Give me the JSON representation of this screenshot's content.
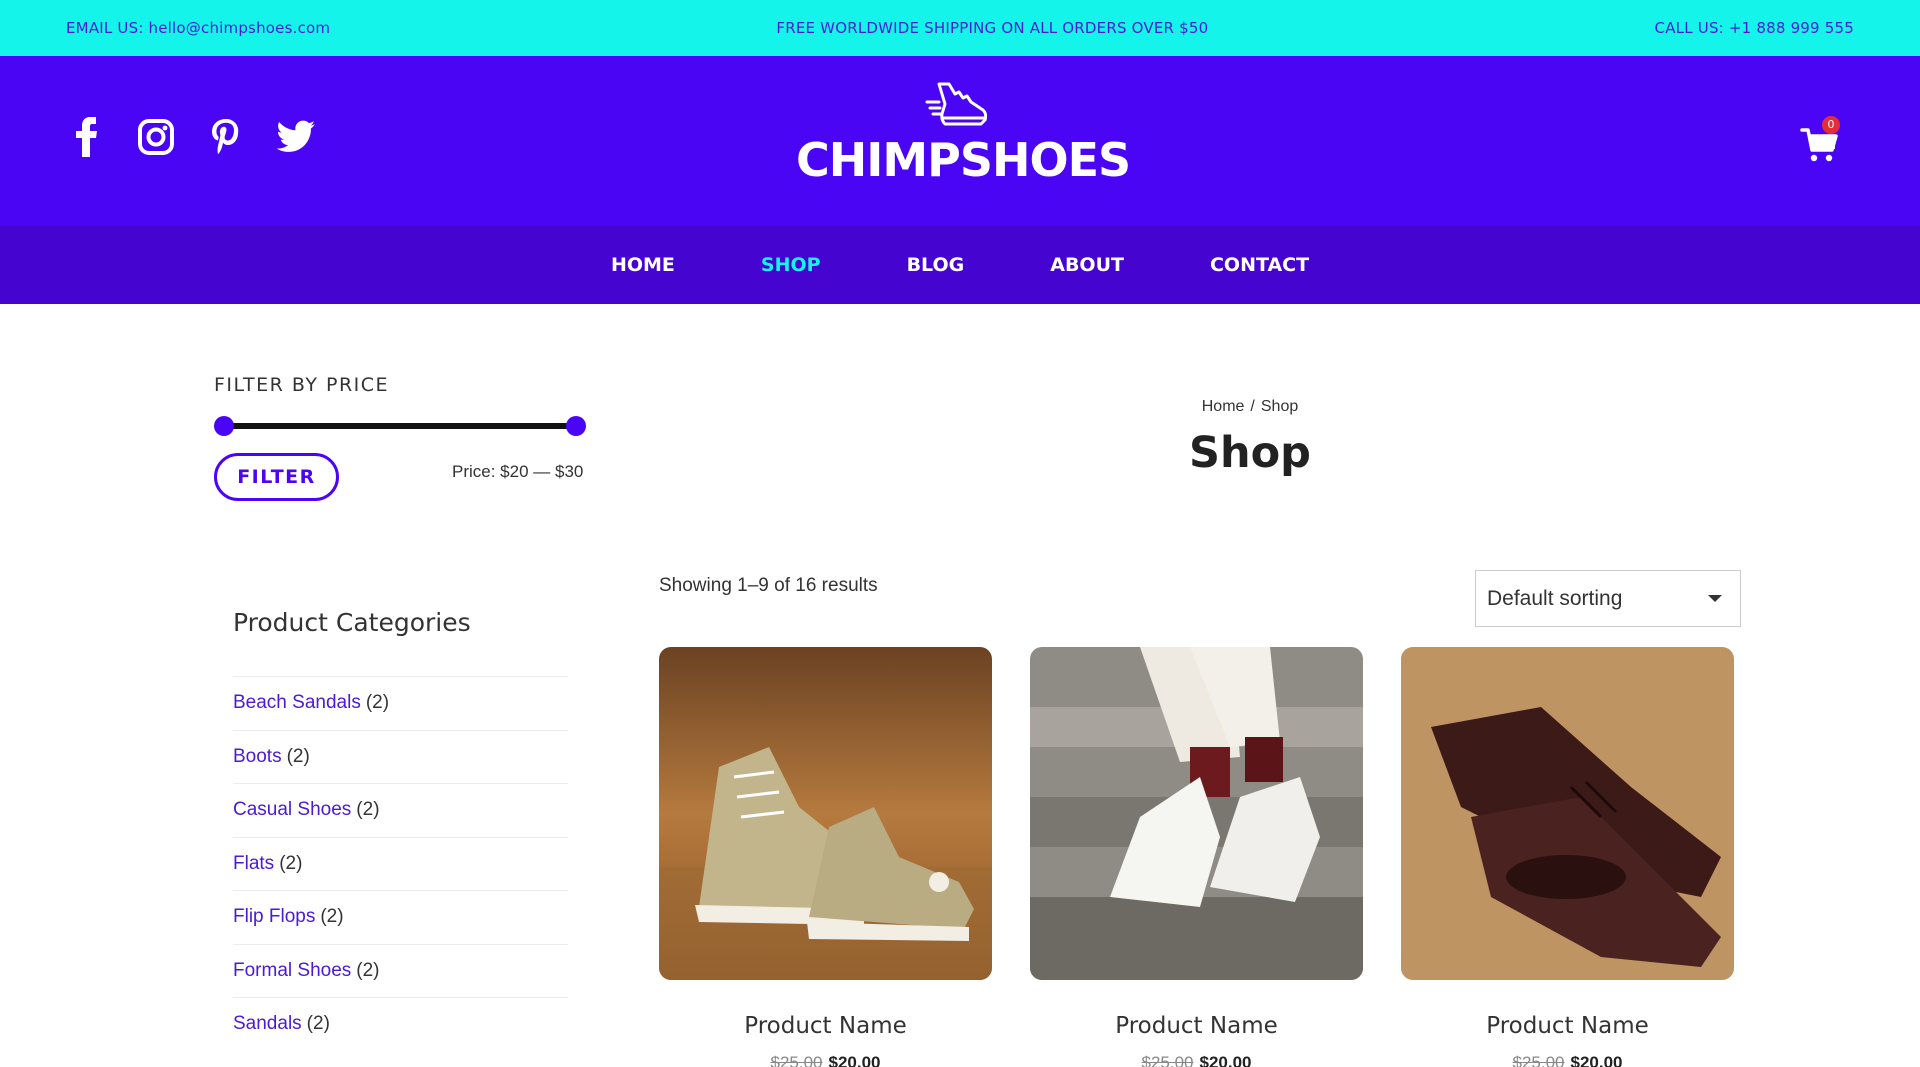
{
  "topbar": {
    "email": "EMAIL US: hello@chimpshoes.com",
    "shipping": "FREE WORLDWIDE SHIPPING ON ALL ORDERS OVER $50",
    "phone": "CALL US: +1 888 999 555"
  },
  "header": {
    "brand": "CHIMPSHOES",
    "social_icons": [
      "facebook-icon",
      "instagram-icon",
      "pinterest-icon",
      "twitter-icon"
    ],
    "cart_count": "0"
  },
  "nav": {
    "items": [
      {
        "label": "HOME"
      },
      {
        "label": "SHOP",
        "active": true
      },
      {
        "label": "BLOG"
      },
      {
        "label": "ABOUT"
      },
      {
        "label": "CONTACT"
      }
    ]
  },
  "sidebar": {
    "filter_title": "FILTER BY PRICE",
    "filter_button": "FILTER",
    "price_label": "Price: $20 — $30",
    "price_range": {
      "min": 20,
      "max": 30
    },
    "categories_title": "Product Categories",
    "categories": [
      {
        "name": "Beach Sandals",
        "count": "(2)"
      },
      {
        "name": "Boots",
        "count": "(2)"
      },
      {
        "name": "Casual Shoes",
        "count": "(2)"
      },
      {
        "name": "Flats",
        "count": "(2)"
      },
      {
        "name": "Flip Flops",
        "count": "(2)"
      },
      {
        "name": "Formal Shoes",
        "count": "(2)"
      },
      {
        "name": "Sandals",
        "count": "(2)"
      }
    ]
  },
  "main": {
    "breadcrumb_home": "Home",
    "breadcrumb_sep": "/",
    "breadcrumb_current": "Shop",
    "title": "Shop",
    "results": "Showing 1–9 of 16 results",
    "sorting": "Default sorting",
    "products": [
      {
        "name": "Product Name",
        "old_price": "$25.00",
        "price": "$20.00"
      },
      {
        "name": "Product Name",
        "old_price": "$25.00",
        "price": "$20.00"
      },
      {
        "name": "Product Name",
        "old_price": "$25.00",
        "price": "$20.00"
      }
    ]
  },
  "colors": {
    "topbar_bg": "#15f4ea",
    "header_bg": "#4a05f5",
    "nav_bg": "#4504d0",
    "accent": "#4a05f5",
    "active_nav": "#15f4ea",
    "badge": "#e52d3a"
  }
}
